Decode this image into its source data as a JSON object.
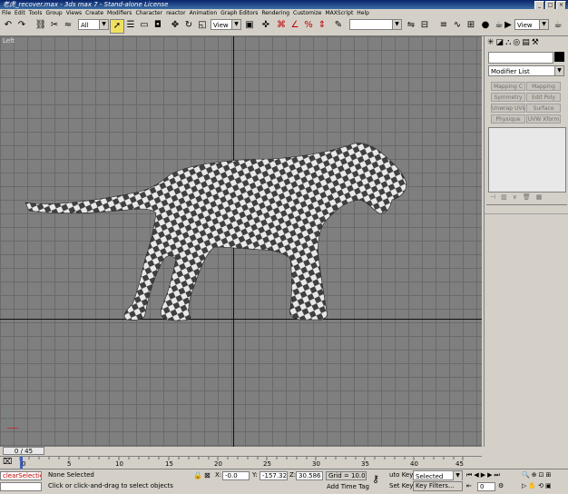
{
  "window": {
    "title": "老虎_recover.max - 3ds max 7 - Stand-alone License",
    "buttons": [
      "_",
      "□",
      "×"
    ]
  },
  "menu": [
    "File",
    "Edit",
    "Tools",
    "Group",
    "Views",
    "Create",
    "Modifiers",
    "Character",
    "reactor",
    "Animation",
    "Graph Editors",
    "Rendering",
    "Customize",
    "MAXScript",
    "Help"
  ],
  "toolbar": {
    "selection_filter": "All",
    "ref_coord": "View",
    "named_selection": "",
    "right_view": "View"
  },
  "viewport": {
    "label": "Left"
  },
  "command_panel": {
    "modifier_list": "Modifier List",
    "buttons": [
      "Mapping C",
      "Mapping",
      "Symmetry",
      "Edit Poly",
      "Unwrap UVW",
      "Surface",
      "Physique",
      "UVW Xform"
    ]
  },
  "timeline": {
    "frame_display": "0 / 45",
    "ticks": [
      "0",
      "5",
      "10",
      "15",
      "20",
      "25",
      "30",
      "35",
      "40",
      "45"
    ]
  },
  "status": {
    "script_listener": "clearSelectio",
    "selection_info": "None Selected",
    "prompt": "Click or click-and-drag to select objects",
    "x_value": "-0.0",
    "y_value": "-157.32",
    "z_value": "30.586",
    "x_label": "X:",
    "y_label": "Y:",
    "z_label": "Z:",
    "grid": "Grid = 10.0",
    "add_time_tag": "Add Time Tag",
    "auto_key": "uto Key",
    "set_key": "Set Key",
    "key_mode": "Selected",
    "key_filters": "Key Filters...",
    "frame_field": "0"
  }
}
